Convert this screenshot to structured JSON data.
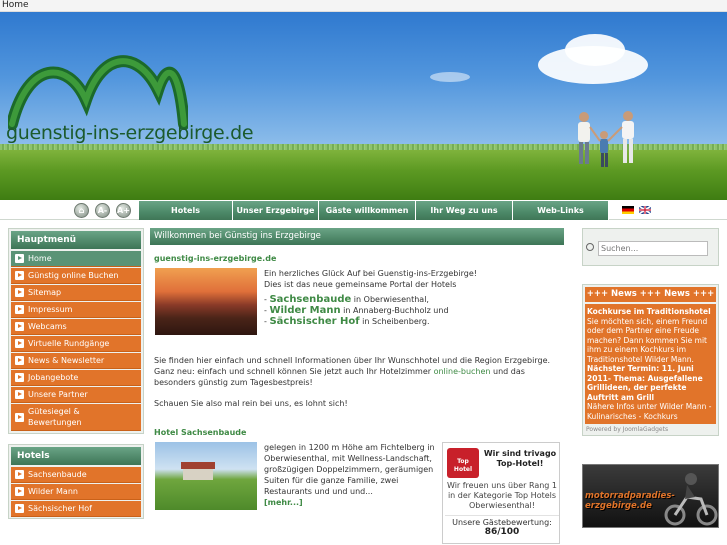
{
  "breadcrumb": "Home",
  "header": {
    "logo_text": "guenstig-ins-erzgebirge.de"
  },
  "font_buttons": [
    {
      "label": "⌂",
      "icon": "home-icon"
    },
    {
      "label": "A-",
      "icon": "decrease-font-icon"
    },
    {
      "label": "A+",
      "icon": "increase-font-icon"
    }
  ],
  "menu": [
    {
      "label": "Hotels"
    },
    {
      "label": "Unser Erzgebirge"
    },
    {
      "label": "Gäste willkommen"
    },
    {
      "label": "Ihr Weg zu uns"
    },
    {
      "label": "Web-Links"
    }
  ],
  "flags": [
    "german-flag-icon",
    "english-flag-icon"
  ],
  "left_menu": {
    "title": "Hauptmenü",
    "items": [
      {
        "label": "Home"
      },
      {
        "label": "Günstig online Buchen"
      },
      {
        "label": "Sitemap"
      },
      {
        "label": "Impressum"
      },
      {
        "label": "Webcams"
      },
      {
        "label": "Virtuelle Rundgänge"
      },
      {
        "label": "News & Newsletter"
      },
      {
        "label": "Jobangebote"
      },
      {
        "label": "Unsere Partner"
      },
      {
        "label": "Gütesiegel & Bewertungen"
      }
    ]
  },
  "hotels_menu": {
    "title": "Hotels",
    "items": [
      {
        "label": "Sachsenbaude"
      },
      {
        "label": "Wilder Mann"
      },
      {
        "label": "Sächsischer Hof"
      }
    ]
  },
  "main": {
    "title": "Willkommen bei Günstig ins Erzgebirge",
    "site_heading": "guenstig-ins-erzgebirge.de",
    "intro_line1": "Ein herzliches Glück Auf bei Guenstig-ins-Erzgebirge!",
    "intro_line2": "Dies ist das neue gemeinsame Portal der Hotels",
    "hotels": [
      {
        "dash": "- ",
        "name": "Sachsenbaude",
        "rest": " in Oberwiesenthal,"
      },
      {
        "dash": "- ",
        "name": "Wilder Mann",
        "rest": " in Annaberg-Buchholz und"
      },
      {
        "dash": "- ",
        "name": "Sächsischer Hof",
        "rest": " in Scheibenberg."
      }
    ],
    "info_p1": "Sie finden hier einfach und schnell Informationen über Ihr Wunschhotel und die Region Erzgebirge.",
    "info_p2a": "Ganz neu: einfach und schnell können Sie jetzt auch Ihr Hotelzimmer ",
    "info_p2_link": "online-buchen",
    "info_p2b": " und das besonders günstig zum Tagesbestpreis!",
    "info_p3": "Schauen Sie also mal rein bei uns, es lohnt sich!",
    "hotel_section_title": "Hotel Sachsenbaude",
    "hotel_text": "gelegen in 1200 m Höhe am Fichtelberg in Oberwiesenthal, mit Wellness-Landschaft, großzügigen Doppelzimmern, geräumigen Suiten für die ganze Familie, zwei Restaurants und und und...",
    "more_link": "[mehr...]",
    "trivago": {
      "badge_line1": "Top",
      "badge_line2": "Hotel",
      "title": "Wir sind trivago Top-Hotel!",
      "text": "Wir freuen uns über Rang 1 in der Kategorie Top Hotels Oberwiesenthal!",
      "rating_label": "Unsere Gästebewertung:",
      "rating_value": "86/100"
    }
  },
  "search": {
    "placeholder": "Suchen..."
  },
  "news": {
    "title": "+++ News +++ News +++",
    "headline": "Kochkurse im Traditionshotel",
    "body1": "Sie möchten sich, einem Freund oder dem Partner eine Freude machen? Dann kommen Sie mit ihm zu einem Kochkurs im Traditionshotel Wilder Mann.",
    "termin": "Nächster Termin: 11. Juni 2011- Thema: Ausgefallene Grillideen, der perfekte Auftritt am Grill",
    "body2": "Nähere Infos unter Wilder Mann - Kulinarisches - Kochkurs",
    "powered": "Powered by JoomlaGadgets"
  },
  "moto_banner": {
    "text_line1": "motorradparadies-",
    "text_line2": "erzgebirge.de"
  }
}
